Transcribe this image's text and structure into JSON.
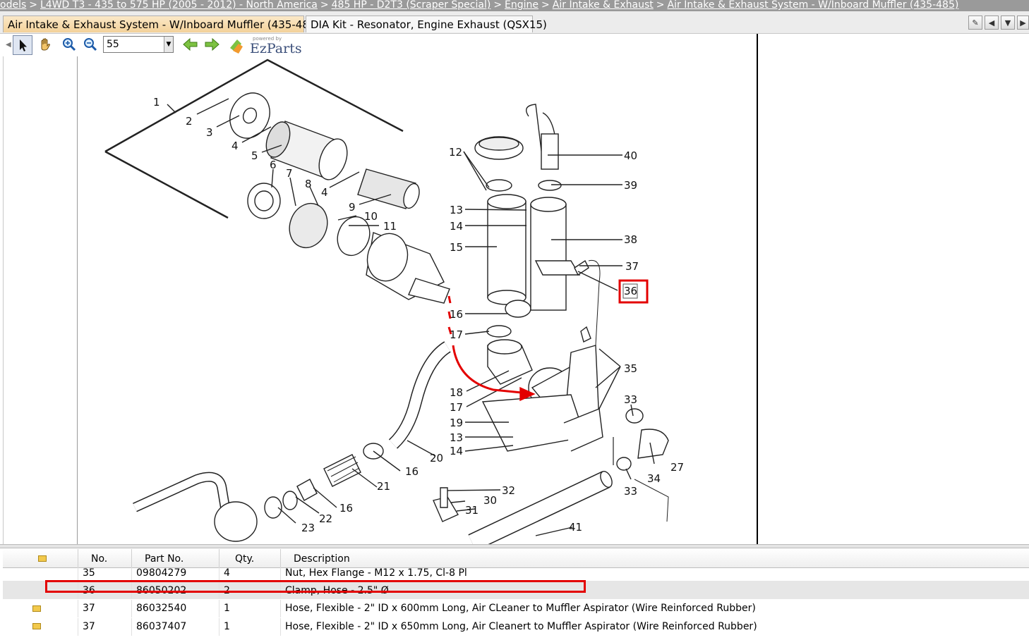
{
  "breadcrumb": [
    "odels",
    "L4WD T3 - 435 to 575 HP (2005 - 2012) - North America",
    "485 HP - D2T3 (Scraper Special)",
    "Engine",
    "Air Intake & Exhaust",
    "Air Intake & Exhaust System - W/Inboard Muffler (435-485)"
  ],
  "breadcrumb_separator": ">",
  "tabs": [
    {
      "label": "Air Intake & Exhaust System - W/Inboard Muffler (435-485)",
      "active": true
    },
    {
      "label": "DIA Kit - Resonator, Engine Exhaust (QSX15)",
      "active": false
    }
  ],
  "tab_buttons": [
    "pin-icon",
    "chevron-left-icon",
    "chevron-down-icon",
    "chevron-right-icon"
  ],
  "toolbar": {
    "zoom_value": "55",
    "tools": [
      "select-arrow-icon",
      "pan-hand-icon",
      "zoom-in-icon",
      "zoom-out-icon",
      "back-arrow-icon",
      "forward-arrow-icon"
    ],
    "logo_small": "powered by",
    "logo_text": "EzParts"
  },
  "diagram": {
    "callouts": [
      "1",
      "2",
      "3",
      "4",
      "5",
      "6",
      "7",
      "8",
      "4",
      "9",
      "10",
      "11",
      "12",
      "13",
      "14",
      "15",
      "16",
      "17",
      "18",
      "17",
      "19",
      "13",
      "14",
      "20",
      "16",
      "21",
      "16",
      "22",
      "23",
      "40",
      "39",
      "38",
      "37",
      "36",
      "35",
      "33",
      "27",
      "34",
      "33",
      "32",
      "30",
      "31",
      "41"
    ],
    "highlighted_callout": "36",
    "accent_color": "#e30000"
  },
  "table": {
    "columns": [
      "No.",
      "Part No.",
      "Qty.",
      "Description"
    ],
    "rows": [
      {
        "no": "35",
        "part": "09804279",
        "qty": "4",
        "desc": "Nut, Hex Flange - M12 x 1.75, Cl-8 Pl",
        "note": false,
        "selected": false
      },
      {
        "no": "36",
        "part": "86050202",
        "qty": "2",
        "desc": "Clamp, Hose - 2.5\" Ø",
        "note": false,
        "selected": true
      },
      {
        "no": "37",
        "part": "86032540",
        "qty": "1",
        "desc": "Hose, Flexible - 2\" ID x 600mm Long, Air CLeaner to Muffler Aspirator (Wire Reinforced Rubber)",
        "note": true,
        "selected": false
      },
      {
        "no": "37",
        "part": "86037407",
        "qty": "1",
        "desc": "Hose, Flexible - 2\" ID x 650mm Long, Air Cleanert to Muffler Aspirator (Wire Reinforced Rubber)",
        "note": true,
        "selected": false
      }
    ]
  }
}
